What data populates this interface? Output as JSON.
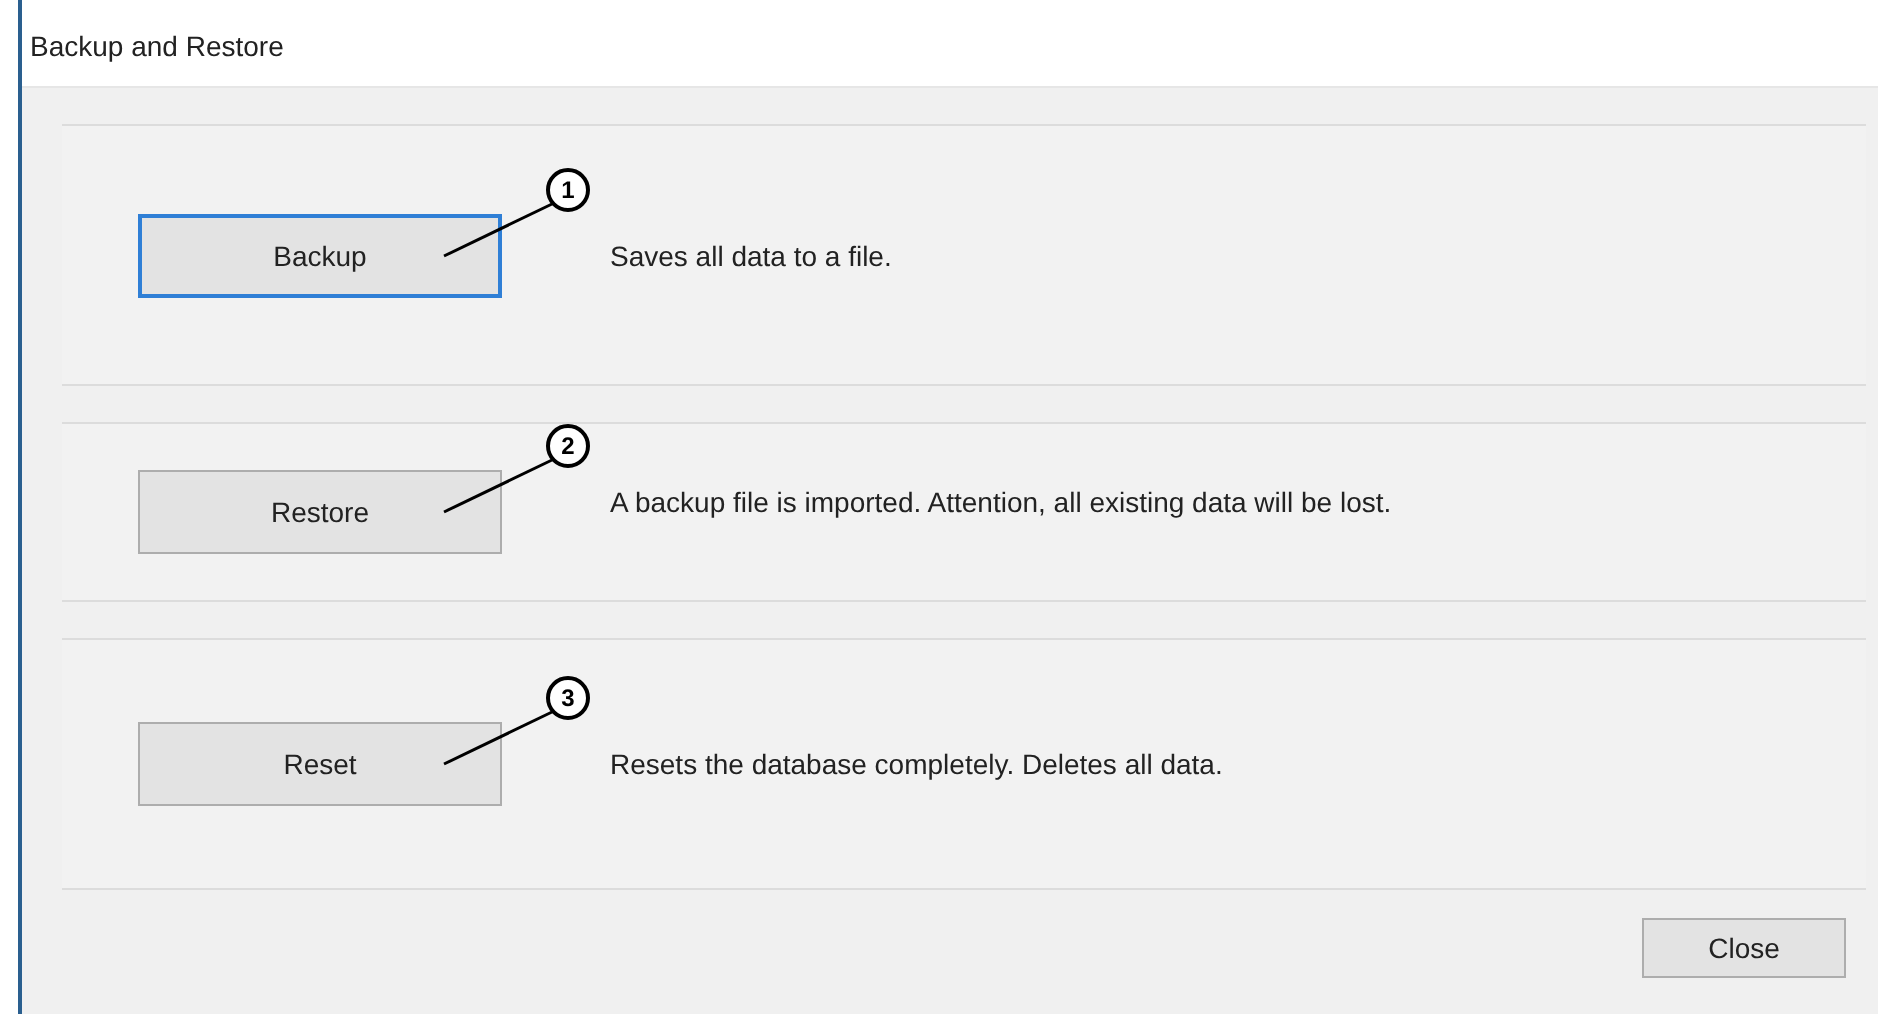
{
  "window": {
    "title": "Backup and Restore"
  },
  "actions": [
    {
      "label": "Backup",
      "focused": true,
      "callout": "1",
      "description": "Saves all data to a file."
    },
    {
      "label": "Restore",
      "focused": false,
      "callout": "2",
      "description": "A backup file is imported. Attention, all existing data will be lost."
    },
    {
      "label": "Reset",
      "focused": false,
      "callout": "3",
      "description": "Resets the database completely. Deletes all data."
    }
  ],
  "close_button": "Close"
}
